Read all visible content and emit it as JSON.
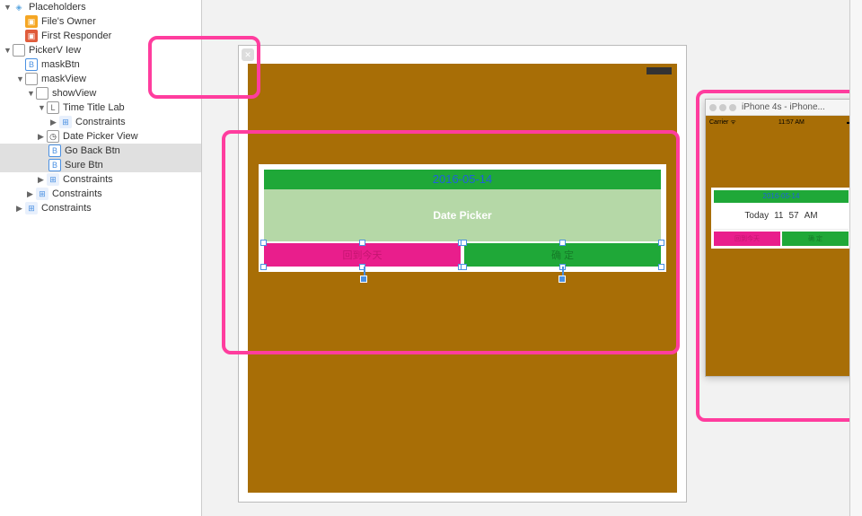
{
  "outline": {
    "placeholders_label": "Placeholders",
    "files_owner": "File's Owner",
    "first_responder": "First Responder",
    "root": "PickerV Iew",
    "maskBtn": "maskBtn",
    "maskView": "maskView",
    "showView": "showView",
    "timeTitleLab": "Time Title Lab",
    "constraints1": "Constraints",
    "datePickerView": "Date Picker View",
    "goBackBtn": "Go Back Btn",
    "sureBtn": "Sure Btn",
    "constraints2": "Constraints",
    "constraints3": "Constraints",
    "constraints4": "Constraints"
  },
  "canvas": {
    "title_text": "2016-05-14",
    "date_picker_label": "Date Picker",
    "goback_label": "回到今天",
    "sure_label": "确 定"
  },
  "simulator": {
    "window_title": "iPhone 4s - iPhone...",
    "carrier": "Carrier",
    "time": "11:57 AM",
    "title_text": "2016-05-14",
    "dp_today": "Today",
    "dp_hour": "11",
    "dp_min": "57",
    "dp_ampm": "AM",
    "goback_label": "回到今天",
    "sure_label": "确 定"
  }
}
